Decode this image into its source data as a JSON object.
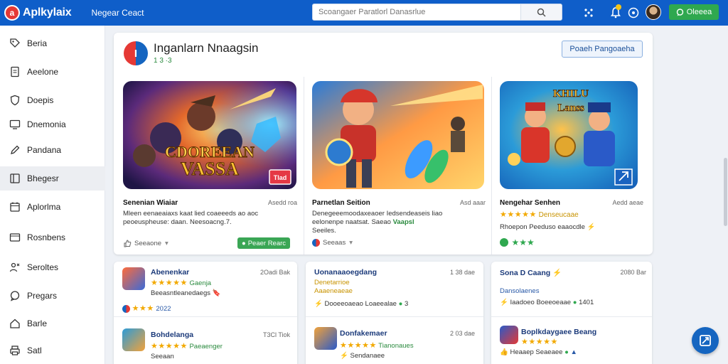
{
  "header": {
    "logo_letter": "a",
    "brand": "Aplkylaix",
    "nav_link": "Negear Ceact",
    "search_placeholder": "Scoangaer Paratlorl Danasrlue",
    "cta_label": "Oleeea"
  },
  "sidebar": {
    "items": [
      {
        "label": "Beria",
        "icon": "tag-icon"
      },
      {
        "label": "Aeelone",
        "icon": "document-icon"
      },
      {
        "label": "Doepis",
        "icon": "shield-icon"
      },
      {
        "label": "Dnemonia",
        "icon": "monitor-icon"
      },
      {
        "label": "Pandana",
        "icon": "pencil-icon"
      },
      {
        "label": "Bhegesr",
        "icon": "book-icon",
        "active": true
      },
      {
        "label": "Aplorlma",
        "icon": "calendar-icon"
      },
      {
        "label": "Rosnbens",
        "icon": "window-icon"
      },
      {
        "label": "Seroltes",
        "icon": "users-icon"
      },
      {
        "label": "Pregars",
        "icon": "chat-icon"
      },
      {
        "label": "Barle",
        "icon": "home-icon"
      },
      {
        "label": "Satl",
        "icon": "printer-icon"
      }
    ]
  },
  "featured": {
    "logo_letter": "I",
    "title": "Inganlarn Nnaagsin",
    "subtitle": "1 3 ·3",
    "action_label": "Poaeh Pangoaeha",
    "games": [
      {
        "image_text_line1": "CDOREEAN",
        "image_text_line2": "VASSA",
        "badge": "Tlad",
        "title": "Senenian Wiaiar",
        "meta": "Asedd roa",
        "desc_line1": "Mleen eenaeaiaxs kaat lied coaeeeds ao aoc",
        "desc_line2": "peoeuspheuse: daan. Neesoacng.7.",
        "foot_label": "Seeaone",
        "install_label": "Peaer Rearc"
      },
      {
        "title": "Parnetlan Seition",
        "meta": "Asd aaar",
        "desc_line1": "Denegeeemoodaxeaoer Iedsendeaseis liao",
        "desc_line2": "eelonenpe naatsat. Saeao",
        "desc_highlight": "Vaapsl",
        "desc_line3": "Seeiles.",
        "foot_label": "Seeaas"
      },
      {
        "image_text_line1": "KHILU",
        "image_text_line2": "Lanss",
        "title": "Nengehar Senhen",
        "meta": "Aedd aeae",
        "rating_stars": "★★★★★",
        "rating_label": "Denseucaae",
        "desc_line1": "Rhoepon Peeduso eaaocdle",
        "green_stars": "★★★"
      }
    ]
  },
  "lists": [
    {
      "rows": [
        {
          "title": "Abenenkar",
          "meta": "2Oadi Bak",
          "stars": "★★★★★",
          "tag": "Gaenja",
          "line": "Beeasntleanedaegs"
        },
        {
          "title": "Bohdelanga",
          "meta": "T3Cl Tiok",
          "stars": "★★★★★",
          "tag": "Paeaenger",
          "line": "Seeaan"
        }
      ],
      "extra_stars": "★★★",
      "extra_value": "2022"
    },
    {
      "rows": [
        {
          "title": "Uonanaaoegdang",
          "meta": "1 38 dae",
          "tag": "Denetarrioe",
          "tag2": "Aaaeneaeae",
          "line": "Dooeeoaeao Loaeealae"
        },
        {
          "title": "Donfakemaer",
          "meta": "2 03 dae",
          "stars": "★★★★★",
          "tag": "Tianonaues",
          "line": "Sendanaee"
        }
      ],
      "extra_value": "3"
    },
    {
      "rows": [
        {
          "title": "Sona D Caang",
          "meta": "2080 Bar",
          "line": "Dansolaenes"
        },
        {
          "title": "Boplkdaygaee Beang",
          "stars": "★★★★★",
          "line": "Heaaep Seaeaee"
        }
      ],
      "line2": "Iaadoeo Boeeoeaae",
      "line2_num": "1401"
    }
  ],
  "colors": {
    "brand_blue": "#0f5ec9",
    "install_green": "#3aa655",
    "star_gold": "#f2a900"
  }
}
